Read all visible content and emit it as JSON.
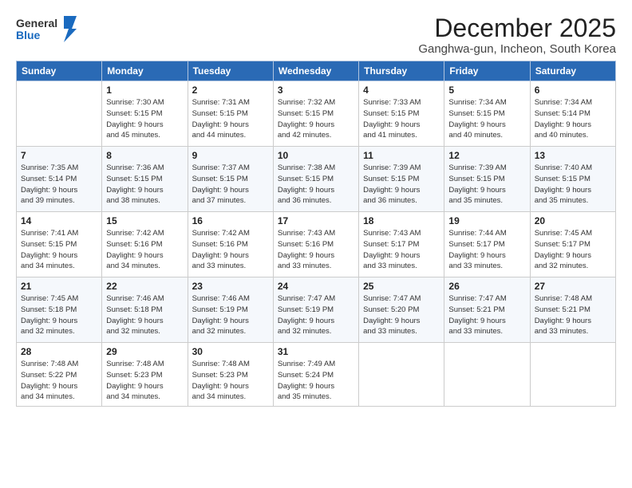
{
  "logo": {
    "general": "General",
    "blue": "Blue"
  },
  "title": "December 2025",
  "subtitle": "Ganghwa-gun, Incheon, South Korea",
  "weekdays": [
    "Sunday",
    "Monday",
    "Tuesday",
    "Wednesday",
    "Thursday",
    "Friday",
    "Saturday"
  ],
  "weeks": [
    [
      {
        "day": "",
        "info": ""
      },
      {
        "day": "1",
        "info": "Sunrise: 7:30 AM\nSunset: 5:15 PM\nDaylight: 9 hours\nand 45 minutes."
      },
      {
        "day": "2",
        "info": "Sunrise: 7:31 AM\nSunset: 5:15 PM\nDaylight: 9 hours\nand 44 minutes."
      },
      {
        "day": "3",
        "info": "Sunrise: 7:32 AM\nSunset: 5:15 PM\nDaylight: 9 hours\nand 42 minutes."
      },
      {
        "day": "4",
        "info": "Sunrise: 7:33 AM\nSunset: 5:15 PM\nDaylight: 9 hours\nand 41 minutes."
      },
      {
        "day": "5",
        "info": "Sunrise: 7:34 AM\nSunset: 5:15 PM\nDaylight: 9 hours\nand 40 minutes."
      },
      {
        "day": "6",
        "info": "Sunrise: 7:34 AM\nSunset: 5:14 PM\nDaylight: 9 hours\nand 40 minutes."
      }
    ],
    [
      {
        "day": "7",
        "info": "Sunrise: 7:35 AM\nSunset: 5:14 PM\nDaylight: 9 hours\nand 39 minutes."
      },
      {
        "day": "8",
        "info": "Sunrise: 7:36 AM\nSunset: 5:15 PM\nDaylight: 9 hours\nand 38 minutes."
      },
      {
        "day": "9",
        "info": "Sunrise: 7:37 AM\nSunset: 5:15 PM\nDaylight: 9 hours\nand 37 minutes."
      },
      {
        "day": "10",
        "info": "Sunrise: 7:38 AM\nSunset: 5:15 PM\nDaylight: 9 hours\nand 36 minutes."
      },
      {
        "day": "11",
        "info": "Sunrise: 7:39 AM\nSunset: 5:15 PM\nDaylight: 9 hours\nand 36 minutes."
      },
      {
        "day": "12",
        "info": "Sunrise: 7:39 AM\nSunset: 5:15 PM\nDaylight: 9 hours\nand 35 minutes."
      },
      {
        "day": "13",
        "info": "Sunrise: 7:40 AM\nSunset: 5:15 PM\nDaylight: 9 hours\nand 35 minutes."
      }
    ],
    [
      {
        "day": "14",
        "info": "Sunrise: 7:41 AM\nSunset: 5:15 PM\nDaylight: 9 hours\nand 34 minutes."
      },
      {
        "day": "15",
        "info": "Sunrise: 7:42 AM\nSunset: 5:16 PM\nDaylight: 9 hours\nand 34 minutes."
      },
      {
        "day": "16",
        "info": "Sunrise: 7:42 AM\nSunset: 5:16 PM\nDaylight: 9 hours\nand 33 minutes."
      },
      {
        "day": "17",
        "info": "Sunrise: 7:43 AM\nSunset: 5:16 PM\nDaylight: 9 hours\nand 33 minutes."
      },
      {
        "day": "18",
        "info": "Sunrise: 7:43 AM\nSunset: 5:17 PM\nDaylight: 9 hours\nand 33 minutes."
      },
      {
        "day": "19",
        "info": "Sunrise: 7:44 AM\nSunset: 5:17 PM\nDaylight: 9 hours\nand 33 minutes."
      },
      {
        "day": "20",
        "info": "Sunrise: 7:45 AM\nSunset: 5:17 PM\nDaylight: 9 hours\nand 32 minutes."
      }
    ],
    [
      {
        "day": "21",
        "info": "Sunrise: 7:45 AM\nSunset: 5:18 PM\nDaylight: 9 hours\nand 32 minutes."
      },
      {
        "day": "22",
        "info": "Sunrise: 7:46 AM\nSunset: 5:18 PM\nDaylight: 9 hours\nand 32 minutes."
      },
      {
        "day": "23",
        "info": "Sunrise: 7:46 AM\nSunset: 5:19 PM\nDaylight: 9 hours\nand 32 minutes."
      },
      {
        "day": "24",
        "info": "Sunrise: 7:47 AM\nSunset: 5:19 PM\nDaylight: 9 hours\nand 32 minutes."
      },
      {
        "day": "25",
        "info": "Sunrise: 7:47 AM\nSunset: 5:20 PM\nDaylight: 9 hours\nand 33 minutes."
      },
      {
        "day": "26",
        "info": "Sunrise: 7:47 AM\nSunset: 5:21 PM\nDaylight: 9 hours\nand 33 minutes."
      },
      {
        "day": "27",
        "info": "Sunrise: 7:48 AM\nSunset: 5:21 PM\nDaylight: 9 hours\nand 33 minutes."
      }
    ],
    [
      {
        "day": "28",
        "info": "Sunrise: 7:48 AM\nSunset: 5:22 PM\nDaylight: 9 hours\nand 34 minutes."
      },
      {
        "day": "29",
        "info": "Sunrise: 7:48 AM\nSunset: 5:23 PM\nDaylight: 9 hours\nand 34 minutes."
      },
      {
        "day": "30",
        "info": "Sunrise: 7:48 AM\nSunset: 5:23 PM\nDaylight: 9 hours\nand 34 minutes."
      },
      {
        "day": "31",
        "info": "Sunrise: 7:49 AM\nSunset: 5:24 PM\nDaylight: 9 hours\nand 35 minutes."
      },
      {
        "day": "",
        "info": ""
      },
      {
        "day": "",
        "info": ""
      },
      {
        "day": "",
        "info": ""
      }
    ]
  ]
}
